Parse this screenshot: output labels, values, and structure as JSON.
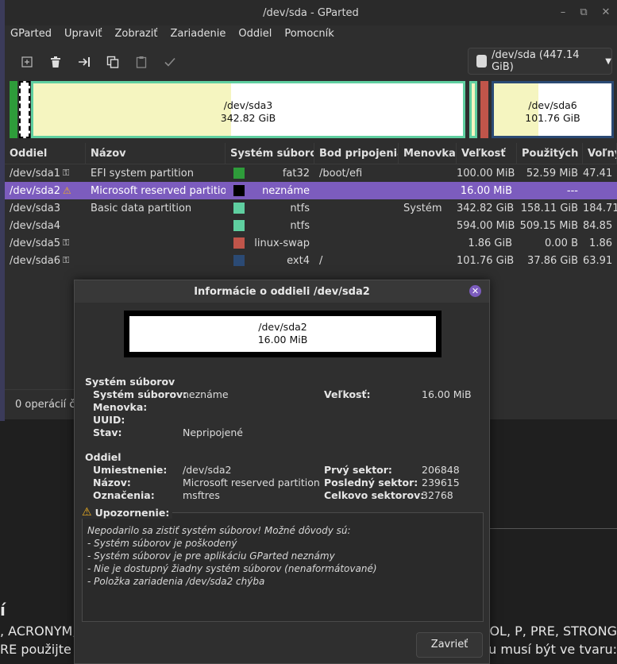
{
  "window": {
    "title": "/dev/sda - GParted",
    "min_glyph": "–",
    "max_glyph": "⧉",
    "close_glyph": "✕"
  },
  "menu": [
    "GParted",
    "Upraviť",
    "Zobraziť",
    "Zariadenie",
    "Oddiel",
    "Pomocník"
  ],
  "toolbar": {
    "icons": [
      "new-partition-icon",
      "delete-icon",
      "resize-move-icon",
      "copy-icon",
      "paste-icon",
      "apply-icon"
    ],
    "device": "/dev/sda  (447.14 GiB)"
  },
  "partition_map": {
    "sda3": {
      "name": "/dev/sda3",
      "size": "342.82 GiB"
    },
    "sda6": {
      "name": "/dev/sda6",
      "size": "101.76 GiB"
    }
  },
  "table": {
    "headers": [
      "Oddiel",
      "Názov",
      "Systém súborov",
      "Bod pripojenia",
      "Menovka",
      "Veľkosť",
      "Použitých",
      "Voľný"
    ],
    "rows": [
      {
        "part": "/dev/sda1",
        "icon": "key",
        "name": "EFI system partition",
        "fs": "fat32",
        "color": "#2e9c3a",
        "mount": "/boot/efi",
        "label": "",
        "size": "100.00 MiB",
        "used": "52.59 MiB",
        "free": "47.41"
      },
      {
        "part": "/dev/sda2",
        "icon": "warning",
        "name": "Microsoft reserved partition",
        "fs": "neznáme",
        "color": "#000000",
        "mount": "",
        "label": "",
        "size": "16.00 MiB",
        "used": "---",
        "free": ""
      },
      {
        "part": "/dev/sda3",
        "icon": "",
        "name": "Basic data partition",
        "fs": "ntfs",
        "color": "#5fcfa0",
        "mount": "",
        "label": "Systém",
        "size": "342.82 GiB",
        "used": "158.11 GiB",
        "free": "184.71"
      },
      {
        "part": "/dev/sda4",
        "icon": "",
        "name": "",
        "fs": "ntfs",
        "color": "#5fcfa0",
        "mount": "",
        "label": "",
        "size": "594.00 MiB",
        "used": "509.15 MiB",
        "free": "84.85"
      },
      {
        "part": "/dev/sda5",
        "icon": "key",
        "name": "",
        "fs": "linux-swap",
        "color": "#c0554a",
        "mount": "",
        "label": "",
        "size": "1.86 GiB",
        "used": "0.00 B",
        "free": "1.86"
      },
      {
        "part": "/dev/sda6",
        "icon": "key",
        "name": "",
        "fs": "ext4",
        "color": "#2b4a74",
        "mount": "/",
        "label": "",
        "size": "101.76 GiB",
        "used": "37.86 GiB",
        "free": "63.91"
      }
    ]
  },
  "status": "0 operácií ča",
  "dialog": {
    "title": "Informácie o oddieli /dev/sda2",
    "close_glyph": "✕",
    "part_name": "/dev/sda2",
    "part_size": "16.00 MiB",
    "fs_section": "Systém súborov",
    "fs_label": "Systém súborov:",
    "fs_value": "neznáme",
    "label_label": "Menovka:",
    "uuid_label": "UUID:",
    "state_label": "Stav:",
    "state_value": "Nepripojené",
    "size_label": "Veľkosť:",
    "size_value": "16.00 MiB",
    "part_section": "Oddiel",
    "path_label": "Umiestnenie:",
    "path_value": "/dev/sda2",
    "name_label": "Názov:",
    "name_value": "Microsoft reserved partition",
    "flags_label": "Označenia:",
    "flags_value": "msftres",
    "first_label": "Prvý sektor:",
    "first_value": "206848",
    "last_label": "Posledný sektor:",
    "last_value": "239615",
    "total_label": "Celkovo sektorov:",
    "total_value": "32768",
    "warning_title": "Upozornenie:",
    "warning_lines": [
      "Nepodarilo sa zistiť systém súborov! Možné dôvody sú:",
      "- Systém súborov je poškodený",
      "- Systém súborov je pre aplikáciu GParted neznámy",
      "- Nie je dostupný žiadny systém súborov (nenaformátované)",
      "- Položka zariadenia /dev/sda2 chýba"
    ],
    "close_button": "Zavrieť"
  },
  "background": {
    "heading": "í",
    "line1_left": ", ACRONYM,",
    "line1_right": "OL, P, PRE, STRONG",
    "line2_left": "RE použijte",
    "line2_right": "u musí být ve tvaru:"
  },
  "colors": {
    "selection": "#7c5cbe",
    "ntfs": "#5fcfa0",
    "ext4": "#2b4a74",
    "fat32": "#2e9c3a",
    "swap": "#c0554a",
    "used_fill": "#f5f5c0"
  }
}
